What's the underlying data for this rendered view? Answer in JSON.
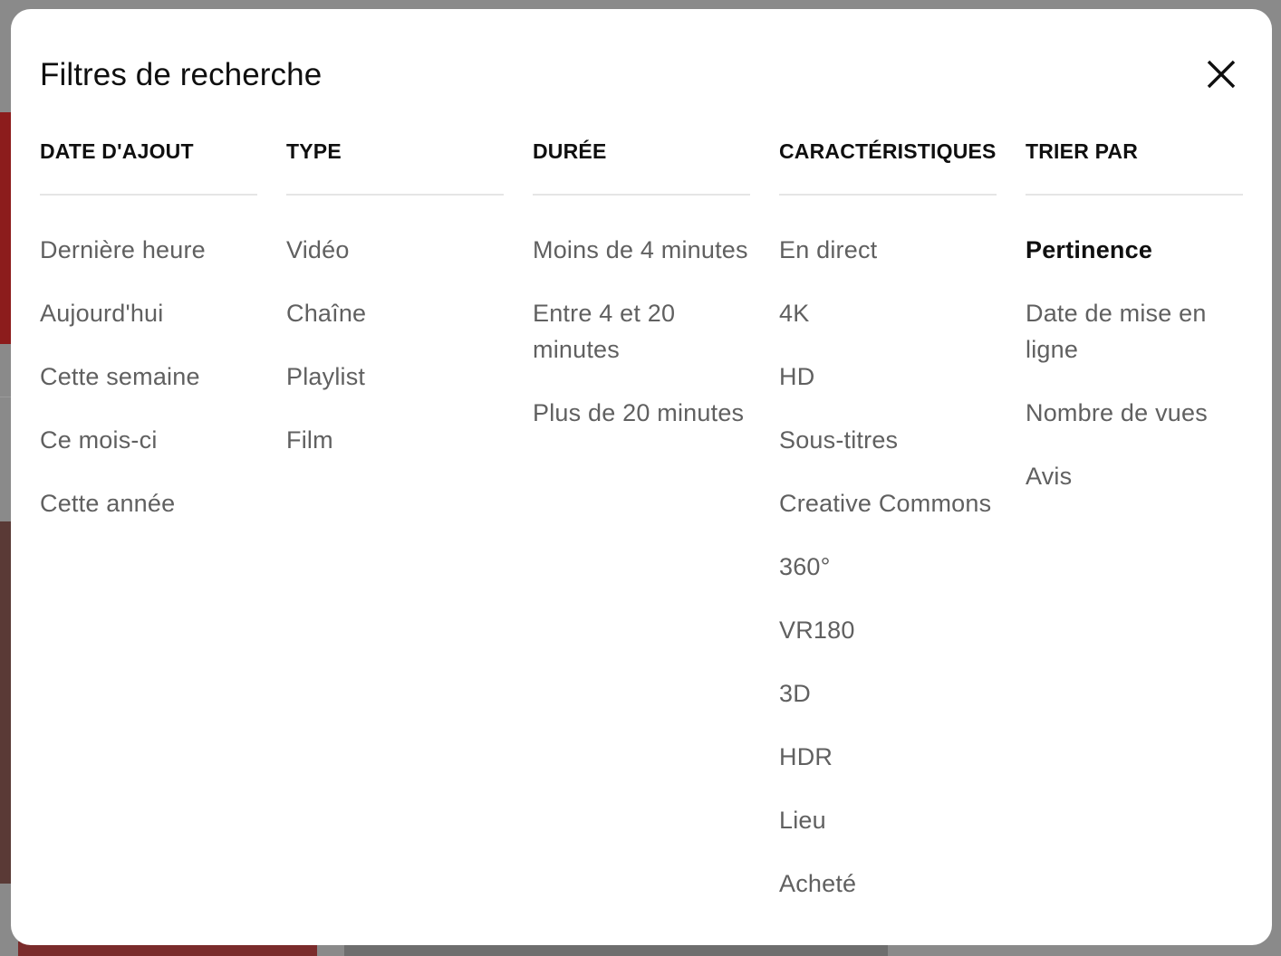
{
  "dialog": {
    "title": "Filtres de recherche",
    "close_icon": "close-icon"
  },
  "columns": [
    {
      "header": "DATE D'AJOUT",
      "options": [
        "Dernière heure",
        "Aujourd'hui",
        "Cette semaine",
        "Ce mois-ci",
        "Cette année"
      ]
    },
    {
      "header": "TYPE",
      "options": [
        "Vidéo",
        "Chaîne",
        "Playlist",
        "Film"
      ]
    },
    {
      "header": "DURÉE",
      "options": [
        "Moins de 4 minutes",
        "Entre 4 et 20 minutes",
        "Plus de 20 minutes"
      ]
    },
    {
      "header": "CARACTÉRISTIQUES",
      "options": [
        "En direct",
        "4K",
        "HD",
        "Sous-titres",
        "Creative Commons",
        "360°",
        "VR180",
        "3D",
        "HDR",
        "Lieu",
        "Acheté"
      ]
    },
    {
      "header": "TRIER PAR",
      "options": [
        "Pertinence",
        "Date de mise en ligne",
        "Nombre de vues",
        "Avis"
      ],
      "selected": "Pertinence"
    }
  ],
  "colors": {
    "title_text": "#0f0f0f",
    "option_text": "#606060",
    "divider": "#e5e5e5",
    "dialog_background": "#ffffff",
    "overlay": "#8a8a8a"
  }
}
